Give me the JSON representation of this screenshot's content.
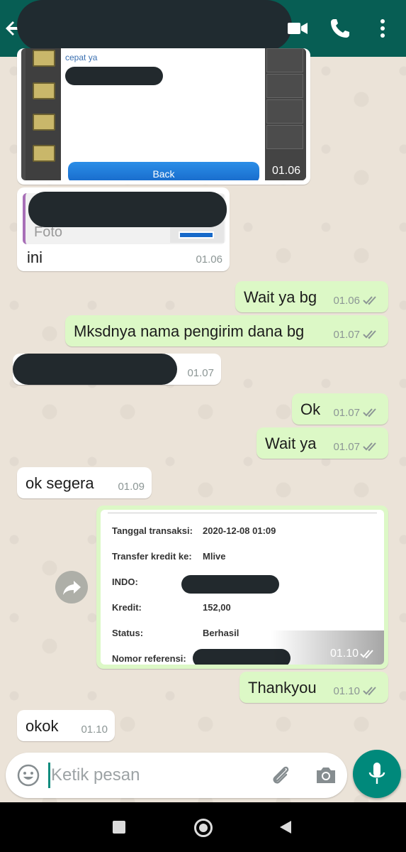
{
  "messages": {
    "m1": {
      "text": "",
      "time": "01.06"
    },
    "m1_shot": {
      "text": "cepat ya",
      "button": "Back"
    },
    "m2": {
      "quote_label": "Foto",
      "text": "ini",
      "time": "01.06"
    },
    "m3": {
      "text": "Wait ya bg",
      "time": "01.06"
    },
    "m4": {
      "text": "Mksdnya nama pengirim dana bg",
      "time": "01.07"
    },
    "m5": {
      "time": "01.07"
    },
    "m6": {
      "text": "Ok",
      "time": "01.07"
    },
    "m7": {
      "text": "Wait ya",
      "time": "01.07"
    },
    "m8": {
      "text": "ok segera",
      "time": "01.09"
    },
    "m9": {
      "time": "01.10",
      "rows": [
        {
          "label": "Tanggal transaksi:",
          "value": "2020-12-08 01:09"
        },
        {
          "label": "Transfer kredit ke:",
          "value": "Mlive"
        },
        {
          "label": "INDO:",
          "value": ""
        },
        {
          "label": "Kredit:",
          "value": "152,00"
        },
        {
          "label": "Status:",
          "value": "Berhasil"
        },
        {
          "label": "Nomor referensi:",
          "value": ""
        }
      ]
    },
    "m10": {
      "text": "Thankyou",
      "time": "01.10"
    },
    "m11": {
      "text": "okok",
      "time": "01.10"
    }
  },
  "input": {
    "placeholder": "Ketik pesan"
  },
  "icons": {
    "back": "arrow-left-icon",
    "video": "video-call-icon",
    "call": "phone-icon",
    "menu": "more-vert-icon",
    "emoji": "emoji-icon",
    "attach": "paperclip-icon",
    "camera": "camera-icon",
    "mic": "mic-icon",
    "forward": "forward-icon",
    "ticks": "double-check-icon"
  },
  "colors": {
    "header": "#075e54",
    "outgoing": "#dcf8c6",
    "incoming": "#ffffff",
    "mic": "#00897b"
  }
}
